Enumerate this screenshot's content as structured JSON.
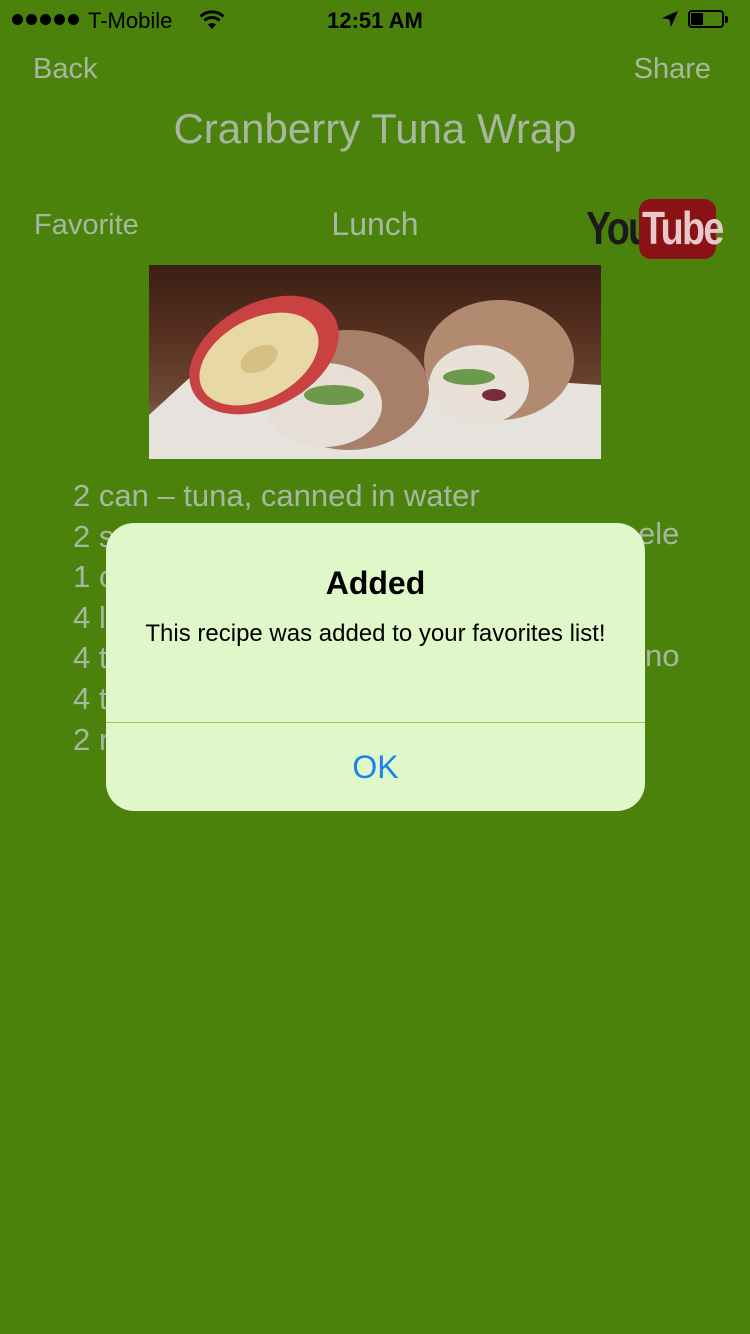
{
  "status_bar": {
    "carrier": "T-Mobile",
    "time": "12:51 AM",
    "signal_bars_filled": 5,
    "battery_level": 0.4
  },
  "nav": {
    "back_label": "Back",
    "share_label": "Share"
  },
  "recipe": {
    "title": "Cranberry Tuna Wrap",
    "favorite_label": "Favorite",
    "category": "Lunch",
    "youtube": {
      "you": "You",
      "tube": "Tube"
    },
    "ingredients": [
      "2 can – tuna, canned in water",
      "2 s",
      "1 c",
      "4 l",
      "4 t",
      "4 t",
      "2 r"
    ],
    "ingredients_right_fragments": [
      "",
      "ele",
      "",
      "",
      "no",
      "",
      ""
    ]
  },
  "alert": {
    "title": "Added",
    "message": "This recipe was added to your favorites list!",
    "ok_label": "OK"
  },
  "colors": {
    "background": "#4b820c",
    "dimmed_text": "#a8b8a0",
    "alert_background": "#dff7c9",
    "alert_button": "#1a82f0"
  }
}
